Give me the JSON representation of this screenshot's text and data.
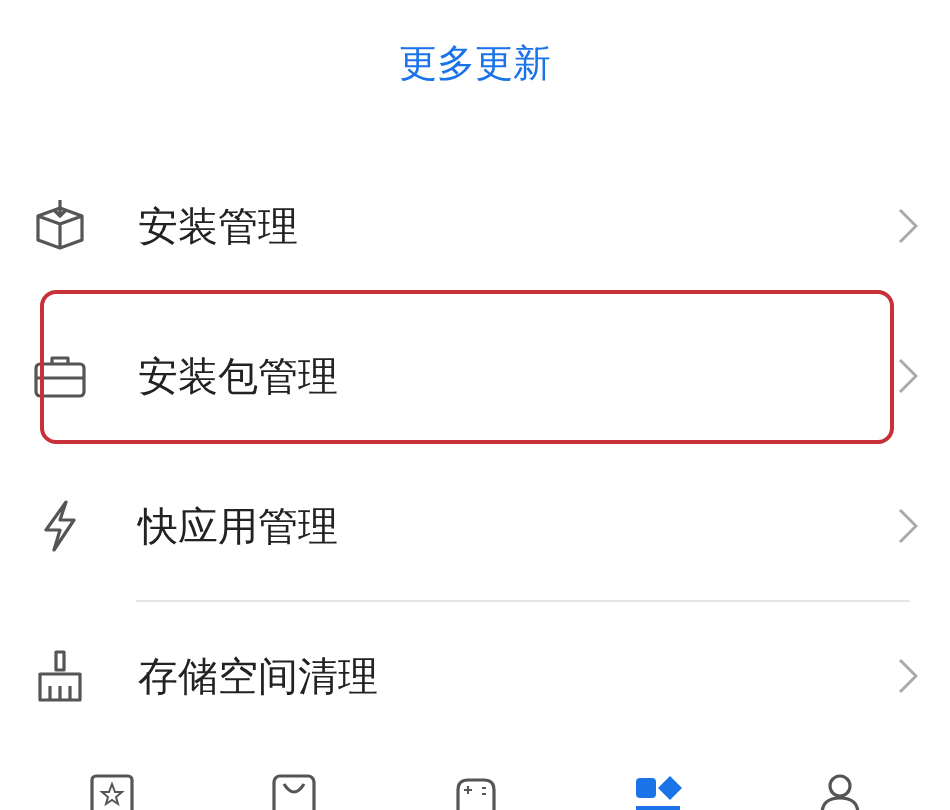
{
  "header_link": "更多更新",
  "items": [
    {
      "label": "安装管理",
      "highlighted": false
    },
    {
      "label": "安装包管理",
      "highlighted": true
    },
    {
      "label": "快应用管理",
      "highlighted": false
    },
    {
      "label": "存储空间清理",
      "highlighted": false
    }
  ],
  "bottom_nav": [
    {
      "selected": false
    },
    {
      "selected": false
    },
    {
      "selected": false
    },
    {
      "selected": true
    },
    {
      "selected": false
    }
  ]
}
